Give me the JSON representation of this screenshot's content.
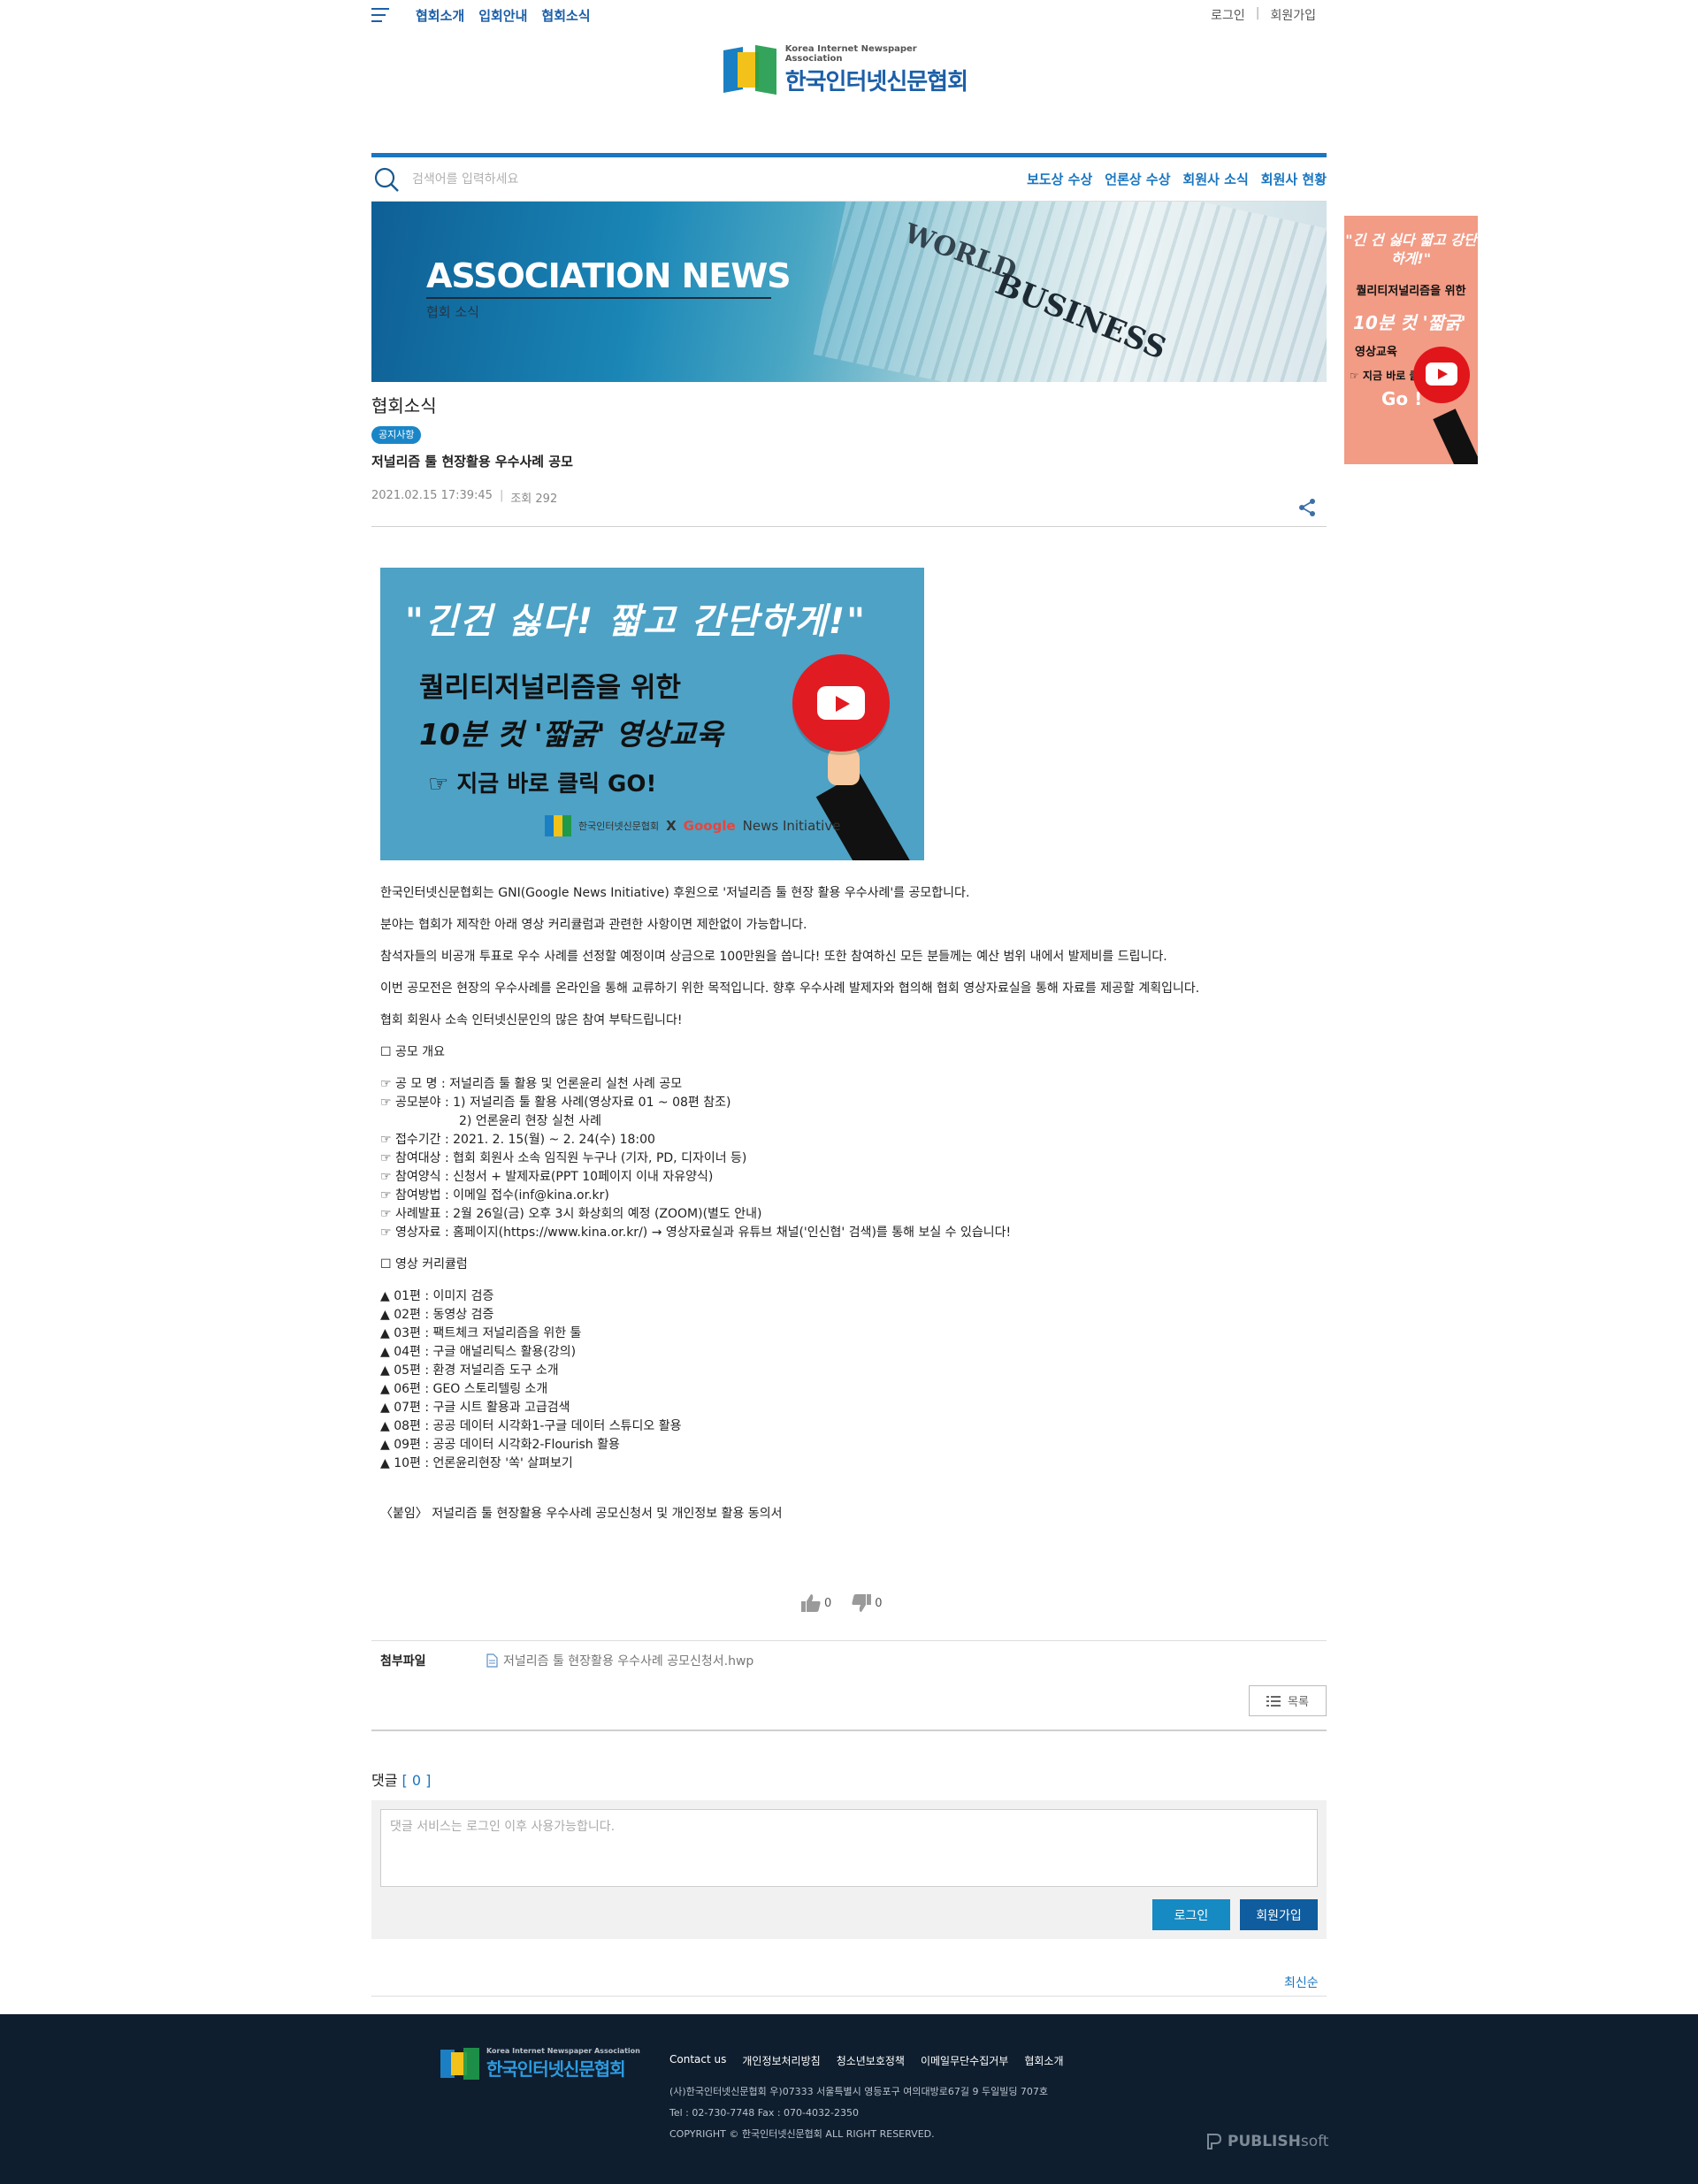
{
  "topbar": {
    "nav": [
      "협회소개",
      "입회안내",
      "협회소식"
    ],
    "login": "로그인",
    "separator": "|",
    "join": "회원가입"
  },
  "logo": {
    "english": "Korea Internet Newspaper Association",
    "korean": "한국인터넷신문협회"
  },
  "search": {
    "placeholder": "검색어를 입력하세요"
  },
  "category_nav": [
    "보도상 수상",
    "언론상 수상",
    "회원사 소식",
    "회원사 현황"
  ],
  "banner": {
    "title": "ASSOCIATION NEWS",
    "subtitle": "협회 소식",
    "bg_words": [
      "WORLD",
      "BUSINESS"
    ]
  },
  "side_ad": {
    "quote": "\"긴 건 싫다 짧고 강단하게!\"",
    "line1": "퀄리티저널리즘을 위한",
    "line2": "10분 컷 '짧굵'",
    "line3": "영상교육",
    "line4": "☞ 지금 바로 클릭",
    "line5": "Go !"
  },
  "article": {
    "board_title": "협회소식",
    "badge": "공지사항",
    "title": "저널리즘 툴 현장활용 우수사례 공모",
    "date": "2021.02.15 17:39:45",
    "views": "조회 292"
  },
  "promo": {
    "quote": "\"긴건 싫다! 짧고 간단하게!\"",
    "line1": "퀄리티저널리즘을 위한",
    "line2": "10분 컷 '짧굵' 영상교육",
    "line3": "☞ 지금 바로  클릭 GO!",
    "footer_org": "한국인터넷신문협회",
    "footer_x": "X",
    "footer_google": "Google",
    "footer_gni": "News Initiative"
  },
  "body": {
    "p1": "한국인터넷신문협회는 GNI(Google News Initiative) 후원으로 '저널리즘 툴 현장 활용 우수사례'를 공모합니다.",
    "p2": "분야는 협회가 제작한 아래 영상 커리큘럼과 관련한 사항이면 제한없이 가능합니다.",
    "p3": "참석자들의 비공개 투표로 우수 사례를 선정할 예정이며 상금으로 100만원을 씁니다! 또한 참여하신 모든 분들께는 예산 범위 내에서 발제비를 드립니다.",
    "p4": "이번 공모전은 현장의 우수사례를 온라인을 통해 교류하기 위한 목적입니다. 향후 우수사례 발제자와 협의해 협회 영상자료실을 통해 자료를 제공할 계획입니다.",
    "p5": "협회 회원사 소속 인터넷신문인의 많은 참여 부탁드립니다!",
    "section1": "☐ 공모 개요",
    "overview": [
      "☞ 공 모 명 : 저널리즘 툴 활용 및 언론윤리 실천 사례 공모",
      "☞ 공모분야 : 1) 저널리즘 툴 활용 사례(영상자료 01 ~ 08편 참조)",
      "2) 언론윤리 현장 실천 사례",
      "☞ 접수기간 : 2021. 2. 15(월) ~ 2. 24(수) 18:00",
      "☞ 참여대상 : 협회 회원사 소속 임직원 누구나 (기자, PD, 디자이너 등)",
      "☞ 참여양식 : 신청서 + 발제자료(PPT 10페이지 이내 자유양식)",
      "☞ 참여방법 : 이메일 접수(inf@kina.or.kr)",
      "☞ 사례발표 : 2월 26일(금) 오후 3시 화상회의 예정 (ZOOM)(별도 안내)",
      "☞ 영상자료 : 홈페이지(https://www.kina.or.kr/) → 영상자료실과 유튜브 채널('인신협' 검색)를 통해 보실 수 있습니다!"
    ],
    "section2": "☐ 영상 커리큘럼",
    "curriculum": [
      "▲ 01편 : 이미지 검증",
      "▲ 02편 : 동영상 검증",
      "▲ 03편 : 팩트체크 저널리즘을 위한 툴",
      "▲ 04편 : 구글 애널리틱스 활용(강의)",
      "▲ 05편 : 환경 저널리즘 도구 소개",
      "▲ 06편 : GEO 스토리텔링 소개",
      "▲ 07편 : 구글 시트 활용과 고급검색",
      "▲ 08편 : 공공 데이터 시각화1-구글 데이터 스튜디오 활용",
      "▲ 09편 : 공공 데이터 시각화2-Flourish 활용",
      "▲ 10편 : 언론윤리현장 '쏙' 살펴보기"
    ],
    "attachment_note": "〈붙임〉 저널리즘 툴 현장활용 우수사례 공모신청서 및 개인정보 활용 동의서"
  },
  "votes": {
    "up": "0",
    "down": "0"
  },
  "attachments": {
    "label": "첨부파일",
    "file": "저널리즘 툴 현장활용 우수사례 공모신청서.hwp"
  },
  "list_button": "목록",
  "comments": {
    "label": "댓글",
    "count_open": "[",
    "count": " 0 ",
    "count_close": "]",
    "placeholder": "댓글 서비스는 로그인 이후 사용가능합니다.",
    "login": "로그인",
    "join": "회원가입"
  },
  "latest_link": "최신순",
  "footer": {
    "logo_en": "Korea Internet Newspaper Association",
    "logo_ko": "한국인터넷신문협회",
    "links": [
      "Contact us",
      "개인정보처리방침",
      "청소년보호정책",
      "이메일무단수집거부",
      "협회소개"
    ],
    "address": "(사)한국인터넷신문협회 우)07333 서울특별시 영등포구 여의대방로67길 9 두일빌딩 707호",
    "phone": "Tel : 02-730-7748 Fax : 070-4032-2350",
    "copyright": "COPYRIGHT © 한국인터넷신문협회 ALL RIGHT RESERVED.",
    "publisher_bold": "PUBLISH",
    "publisher_soft": "soft"
  },
  "colors": {
    "brand_blue": "#1a76c0",
    "badge_blue": "#1a86c8",
    "footer_bg": "#0f1e2e",
    "promo_bg": "#4da2c6",
    "ad_bg": "#f29b85"
  }
}
